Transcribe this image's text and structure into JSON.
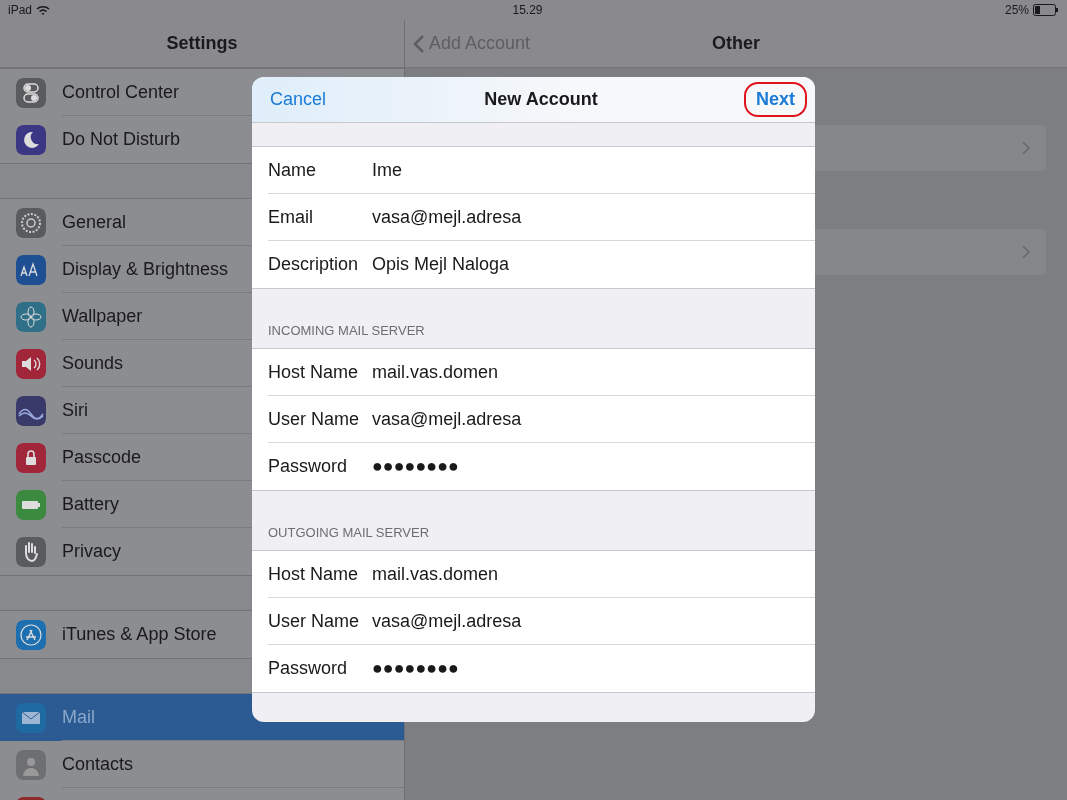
{
  "status_bar": {
    "device": "iPad",
    "time": "15.29",
    "battery": "25%"
  },
  "sidebar": {
    "title": "Settings",
    "groups": [
      [
        {
          "label": "Control Center",
          "kind": "toggles",
          "color": "#5a5b5f",
          "selected": false
        },
        {
          "label": "Do Not Disturb",
          "kind": "moon",
          "color": "#3b3785",
          "selected": false
        }
      ],
      [
        {
          "label": "General",
          "kind": "gear",
          "color": "#5a5b5f",
          "selected": false
        },
        {
          "label": "Display & Brightness",
          "kind": "aa",
          "color": "#1f4f93",
          "selected": false
        },
        {
          "label": "Wallpaper",
          "kind": "flower",
          "color": "#2f6f87",
          "selected": false
        },
        {
          "label": "Sounds",
          "kind": "speaker",
          "color": "#a1263a",
          "selected": false
        },
        {
          "label": "Siri",
          "kind": "wave",
          "color": "#3a3a6a",
          "selected": false
        },
        {
          "label": "Passcode",
          "kind": "lock",
          "color": "#a1263a",
          "selected": false
        },
        {
          "label": "Battery",
          "kind": "battery",
          "color": "#3b8a3f",
          "selected": false
        },
        {
          "label": "Privacy",
          "kind": "hand",
          "color": "#5a5b5f",
          "selected": false
        }
      ],
      [
        {
          "label": "iTunes & App Store",
          "kind": "appstore",
          "color": "#1e6fb0",
          "selected": false
        }
      ],
      [
        {
          "label": "Mail",
          "kind": "envelope",
          "color": "#1f6aa3",
          "selected": true
        },
        {
          "label": "Contacts",
          "kind": "person",
          "color": "#6e6f72",
          "selected": false
        },
        {
          "kind": "plain",
          "color": "#8e2a2a",
          "selected": false
        }
      ]
    ]
  },
  "detail": {
    "back": "Add Account",
    "title": "Other"
  },
  "dialog": {
    "cancel": "Cancel",
    "title": "New Account",
    "next": "Next",
    "next_circled": true,
    "sections": [
      {
        "fields": [
          {
            "label": "Name",
            "value": "Ime"
          },
          {
            "label": "Email",
            "value": "vasa@mejl.adresa"
          },
          {
            "label": "Description",
            "value": "Opis Mejl Naloga"
          }
        ]
      },
      {
        "header": "INCOMING MAIL SERVER",
        "fields": [
          {
            "label": "Host Name",
            "value": "mail.vas.domen"
          },
          {
            "label": "User Name",
            "value": "vasa@mejl.adresa"
          },
          {
            "label": "Password",
            "value": "●●●●●●●●"
          }
        ]
      },
      {
        "header": "OUTGOING MAIL SERVER",
        "fields": [
          {
            "label": "Host Name",
            "value": "mail.vas.domen"
          },
          {
            "label": "User Name",
            "value": "vasa@mejl.adresa"
          },
          {
            "label": "Password",
            "value": "●●●●●●●●"
          }
        ]
      }
    ]
  }
}
